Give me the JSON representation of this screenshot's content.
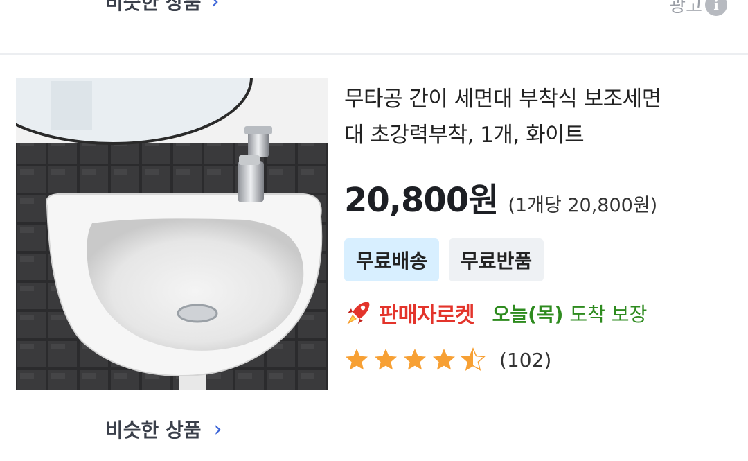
{
  "top": {
    "similar_label": "비슷한 상품",
    "ad_label": "광고",
    "info_glyph": "i"
  },
  "product": {
    "title_line1": "무타공 간이 세면대 부착식 보조세면",
    "title_line2": "대 초강력부착, 1개, 화이트",
    "price": "20,800원",
    "unit_price": "(1개당 20,800원)",
    "badges": [
      "무료배송",
      "무료반품"
    ],
    "rocket_brand": "판매자로켓",
    "arrival_day": "오늘(목)",
    "arrival_text": "도착 보장",
    "rating": 4.5,
    "review_count": "(102)",
    "image_icon": "sink-product-image"
  },
  "bottom": {
    "similar_label": "비슷한 상품"
  },
  "colors": {
    "star": "#f7a034",
    "rocket_red": "#e3342b",
    "arrival_green": "#2e8b1f",
    "badge_blue": "#d8efff",
    "badge_gray": "#eef1f4",
    "link_chevron": "#3b64d8"
  }
}
